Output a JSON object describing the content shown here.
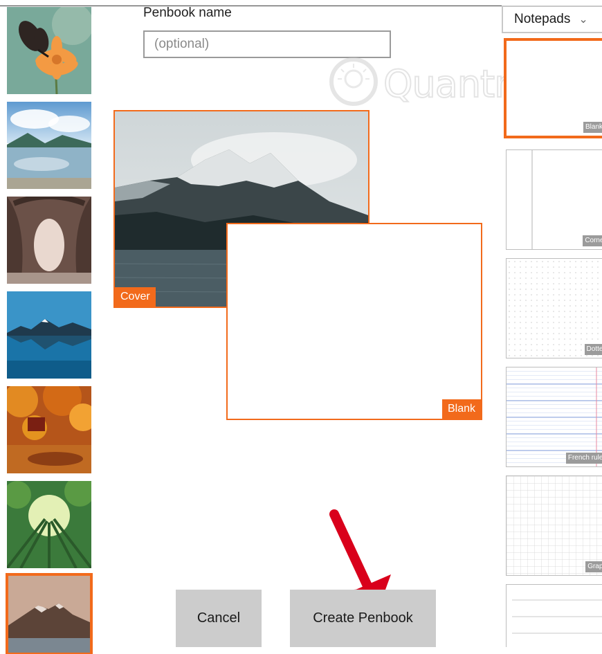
{
  "penbook": {
    "name_label": "Penbook name",
    "name_placeholder": "(optional)",
    "name_value": ""
  },
  "watermark_text": "Quantrimang",
  "preview": {
    "cover_tag": "Cover",
    "page_tag": "Blank"
  },
  "buttons": {
    "cancel": "Cancel",
    "create": "Create Penbook"
  },
  "template_dropdown": {
    "selected": "Notepads"
  },
  "templates": [
    {
      "label": "Blank",
      "selected": true
    },
    {
      "label": "Cornell",
      "selected": false
    },
    {
      "label": "Dotted",
      "selected": false
    },
    {
      "label": "French ruled",
      "selected": false
    },
    {
      "label": "Graph",
      "selected": false
    },
    {
      "label": "",
      "selected": false
    }
  ],
  "covers": [
    {
      "name": "butterfly-flower",
      "selected": false
    },
    {
      "name": "lake-clouds",
      "selected": false
    },
    {
      "name": "tree-tunnel",
      "selected": false
    },
    {
      "name": "blue-lake-reflection",
      "selected": false
    },
    {
      "name": "autumn-forest",
      "selected": false
    },
    {
      "name": "bamboo-forest",
      "selected": false
    },
    {
      "name": "snowy-mountain",
      "selected": true
    }
  ],
  "colors": {
    "accent": "#f26a1b",
    "button_bg": "#cccccc",
    "arrow": "#d9001b"
  }
}
